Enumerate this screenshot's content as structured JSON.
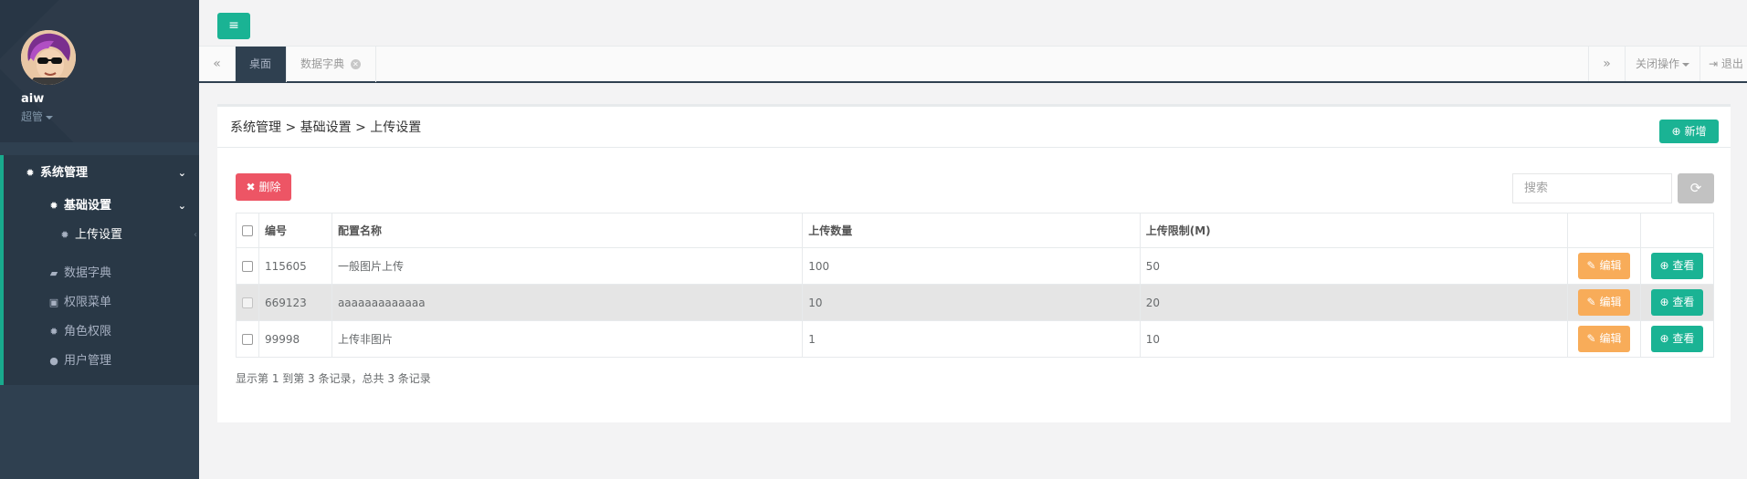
{
  "user": {
    "name": "aiw",
    "role": "超管"
  },
  "sidebar": {
    "items": [
      {
        "label": "系统管理",
        "icon": "gear-icon"
      },
      {
        "label": "基础设置",
        "icon": "gear-icon"
      },
      {
        "label": "上传设置",
        "icon": "gear-icon"
      },
      {
        "label": "数据字典",
        "icon": "book-icon"
      },
      {
        "label": "权限菜单",
        "icon": "save-icon"
      },
      {
        "label": "角色权限",
        "icon": "gear-icon"
      },
      {
        "label": "用户管理",
        "icon": "users-icon"
      }
    ]
  },
  "topbar": {
    "menu_icon": "≡"
  },
  "tabs": {
    "prev": "«",
    "next": "»",
    "items": [
      {
        "label": "桌面",
        "active": true
      },
      {
        "label": "数据字典",
        "active": false
      }
    ],
    "close_ops": "关闭操作",
    "logout": "退出"
  },
  "main": {
    "breadcrumb": "系统管理 > 基础设置 > 上传设置",
    "add_label": "新增",
    "delete_label": "删除",
    "search_placeholder": "搜索",
    "table": {
      "headers": [
        "编号",
        "配置名称",
        "上传数量",
        "上传限制(M)"
      ],
      "rows": [
        {
          "id": "115605",
          "name": "一般图片上传",
          "count": "100",
          "limit": "50",
          "highlighted": false
        },
        {
          "id": "669123",
          "name": "aaaaaaaaaaaaa",
          "count": "10",
          "limit": "20",
          "highlighted": true
        },
        {
          "id": "99998",
          "name": "上传非图片",
          "count": "1",
          "limit": "10",
          "highlighted": false
        }
      ],
      "edit_label": "编辑",
      "view_label": "查看"
    },
    "footer": "显示第 1 到第 3 条记录，总共 3 条记录"
  },
  "colors": {
    "sidebar": "#2f4050",
    "primary": "#1ab394",
    "danger": "#ed5565",
    "warning": "#f8ac59"
  }
}
